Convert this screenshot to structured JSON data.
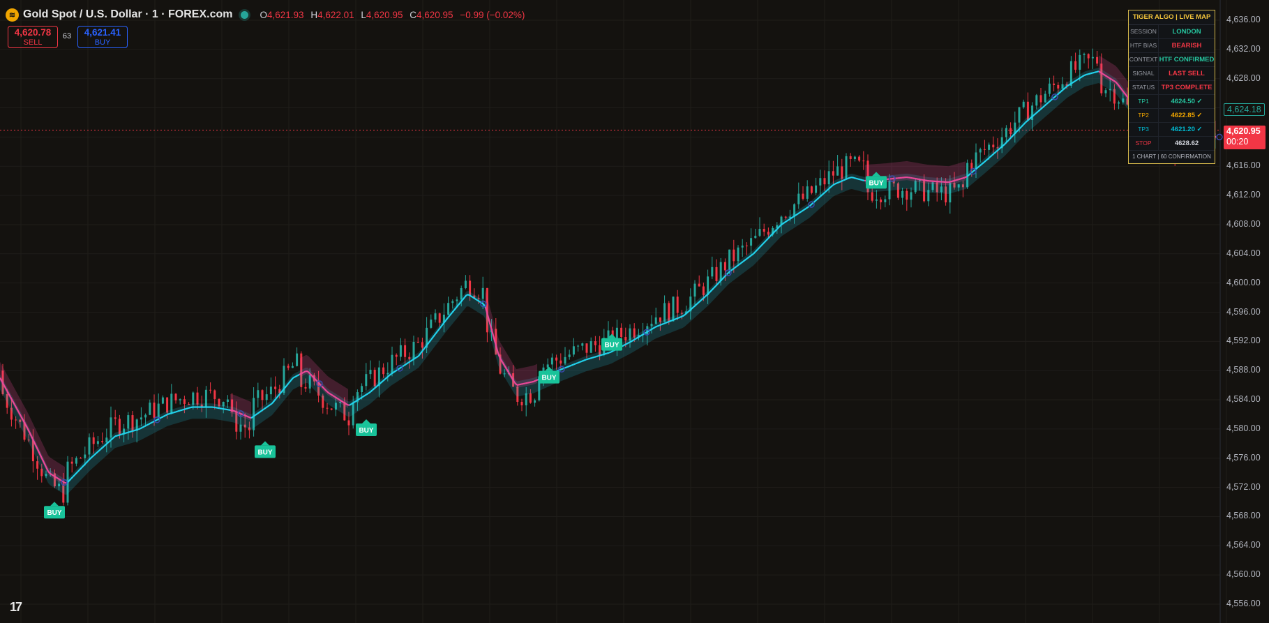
{
  "header": {
    "symbol_title": "Gold Spot / U.S. Dollar · 1 · FOREX.com",
    "open_label": "O",
    "open": "4,621.93",
    "high_label": "H",
    "high": "4,622.01",
    "low_label": "L",
    "low": "4,620.95",
    "close_label": "C",
    "close": "4,620.95",
    "change": "−0.99 (−0.02%)"
  },
  "trade": {
    "sell_price": "4,620.78",
    "sell_label": "SELL",
    "spread": "63",
    "buy_price": "4,621.41",
    "buy_label": "BUY"
  },
  "price_axis": {
    "ticks": [
      "4,636.00",
      "4,632.00",
      "4,628.00",
      "4,624.00",
      "4,620.00",
      "4,616.00",
      "4,612.00",
      "4,608.00",
      "4,604.00",
      "4,600.00",
      "4,596.00",
      "4,592.00",
      "4,588.00",
      "4,584.00",
      "4,580.00",
      "4,576.00",
      "4,572.00",
      "4,568.00",
      "4,564.00",
      "4,560.00",
      "4,556.00"
    ],
    "green_tag": "4,624.18",
    "last_price": "4,620.95",
    "countdown": "00:20"
  },
  "panel": {
    "title": "TIGER ALGO | LIVE MAP",
    "rows": [
      {
        "label": "SESSION",
        "value": "LONDON",
        "color": "#26c6a0"
      },
      {
        "label": "HTF BIAS",
        "value": "BEARISH",
        "color": "#f23645"
      },
      {
        "label": "CONTEXT",
        "value": "HTF CONFIRMED",
        "color": "#26c6a0"
      },
      {
        "label": "SIGNAL",
        "value": "LAST SELL",
        "color": "#f23645"
      },
      {
        "label": "STATUS",
        "value": "TP3 COMPLETE",
        "color": "#f23645"
      },
      {
        "label": "TP1",
        "value": "4624.50 ✓",
        "color": "#26c6a0",
        "label_color": "#26c6a0"
      },
      {
        "label": "TP2",
        "value": "4622.85 ✓",
        "color": "#f0a500",
        "label_color": "#f0a500"
      },
      {
        "label": "TP3",
        "value": "4621.20 ✓",
        "color": "#00bcd4",
        "label_color": "#00bcd4"
      },
      {
        "label": "STOP",
        "value": "4628.62",
        "color": "#d1d4dc",
        "label_color": "#f23645"
      }
    ],
    "footer": "1 CHART | 60 CONFIRMATION"
  },
  "signals": {
    "buy_label": "BUY"
  },
  "colors": {
    "up": "#26a69a",
    "down": "#f23645",
    "bull_line": "#22d3ee",
    "bear_line": "#ec4899",
    "signal": "#19c39a"
  },
  "chart_data": {
    "type": "candlestick",
    "ylim": [
      4554,
      4638
    ],
    "trend_line": [
      [
        0,
        4587
      ],
      [
        40,
        4580
      ],
      [
        70,
        4574
      ],
      [
        95,
        4572.5
      ],
      [
        130,
        4576
      ],
      [
        165,
        4579
      ],
      [
        200,
        4580
      ],
      [
        240,
        4582
      ],
      [
        275,
        4583
      ],
      [
        305,
        4583
      ],
      [
        335,
        4582.5
      ],
      [
        360,
        4581.5
      ],
      [
        390,
        4583.5
      ],
      [
        420,
        4587
      ],
      [
        440,
        4588
      ],
      [
        470,
        4585
      ],
      [
        500,
        4583.2
      ],
      [
        530,
        4585
      ],
      [
        560,
        4587.5
      ],
      [
        600,
        4590
      ],
      [
        640,
        4595
      ],
      [
        670,
        4598.5
      ],
      [
        695,
        4597
      ],
      [
        715,
        4590
      ],
      [
        740,
        4586
      ],
      [
        765,
        4586.5
      ],
      [
        800,
        4588
      ],
      [
        840,
        4589.5
      ],
      [
        875,
        4590.5
      ],
      [
        905,
        4592
      ],
      [
        940,
        4594
      ],
      [
        980,
        4595.5
      ],
      [
        1015,
        4598.5
      ],
      [
        1045,
        4601.5
      ],
      [
        1080,
        4604
      ],
      [
        1120,
        4608
      ],
      [
        1160,
        4610.5
      ],
      [
        1195,
        4613.5
      ],
      [
        1220,
        4614.5
      ],
      [
        1240,
        4614
      ],
      [
        1270,
        4614.2
      ],
      [
        1300,
        4614.5
      ],
      [
        1330,
        4614
      ],
      [
        1360,
        4613.8
      ],
      [
        1385,
        4614.5
      ],
      [
        1410,
        4616.5
      ],
      [
        1440,
        4619
      ],
      [
        1470,
        4622
      ],
      [
        1500,
        4624.5
      ],
      [
        1530,
        4627
      ],
      [
        1555,
        4628.5
      ],
      [
        1575,
        4629
      ],
      [
        1600,
        4627.5
      ],
      [
        1620,
        4625
      ],
      [
        1650,
        4622
      ],
      [
        1680,
        4620.5
      ],
      [
        1745,
        4620
      ]
    ],
    "bear_segments": [
      [
        0,
        95
      ],
      [
        330,
        360
      ],
      [
        430,
        500
      ],
      [
        695,
        770
      ],
      [
        1240,
        1385
      ],
      [
        1575,
        1745
      ]
    ],
    "buy_signals": [
      {
        "x": 78,
        "price": 4568.5
      },
      {
        "x": 380,
        "price": 4576.8
      },
      {
        "x": 525,
        "price": 4579.8
      },
      {
        "x": 787,
        "price": 4587
      },
      {
        "x": 877,
        "price": 4591.5
      },
      {
        "x": 1256,
        "price": 4613.7
      }
    ],
    "last_price": 4620.95,
    "candles_generated": true
  }
}
